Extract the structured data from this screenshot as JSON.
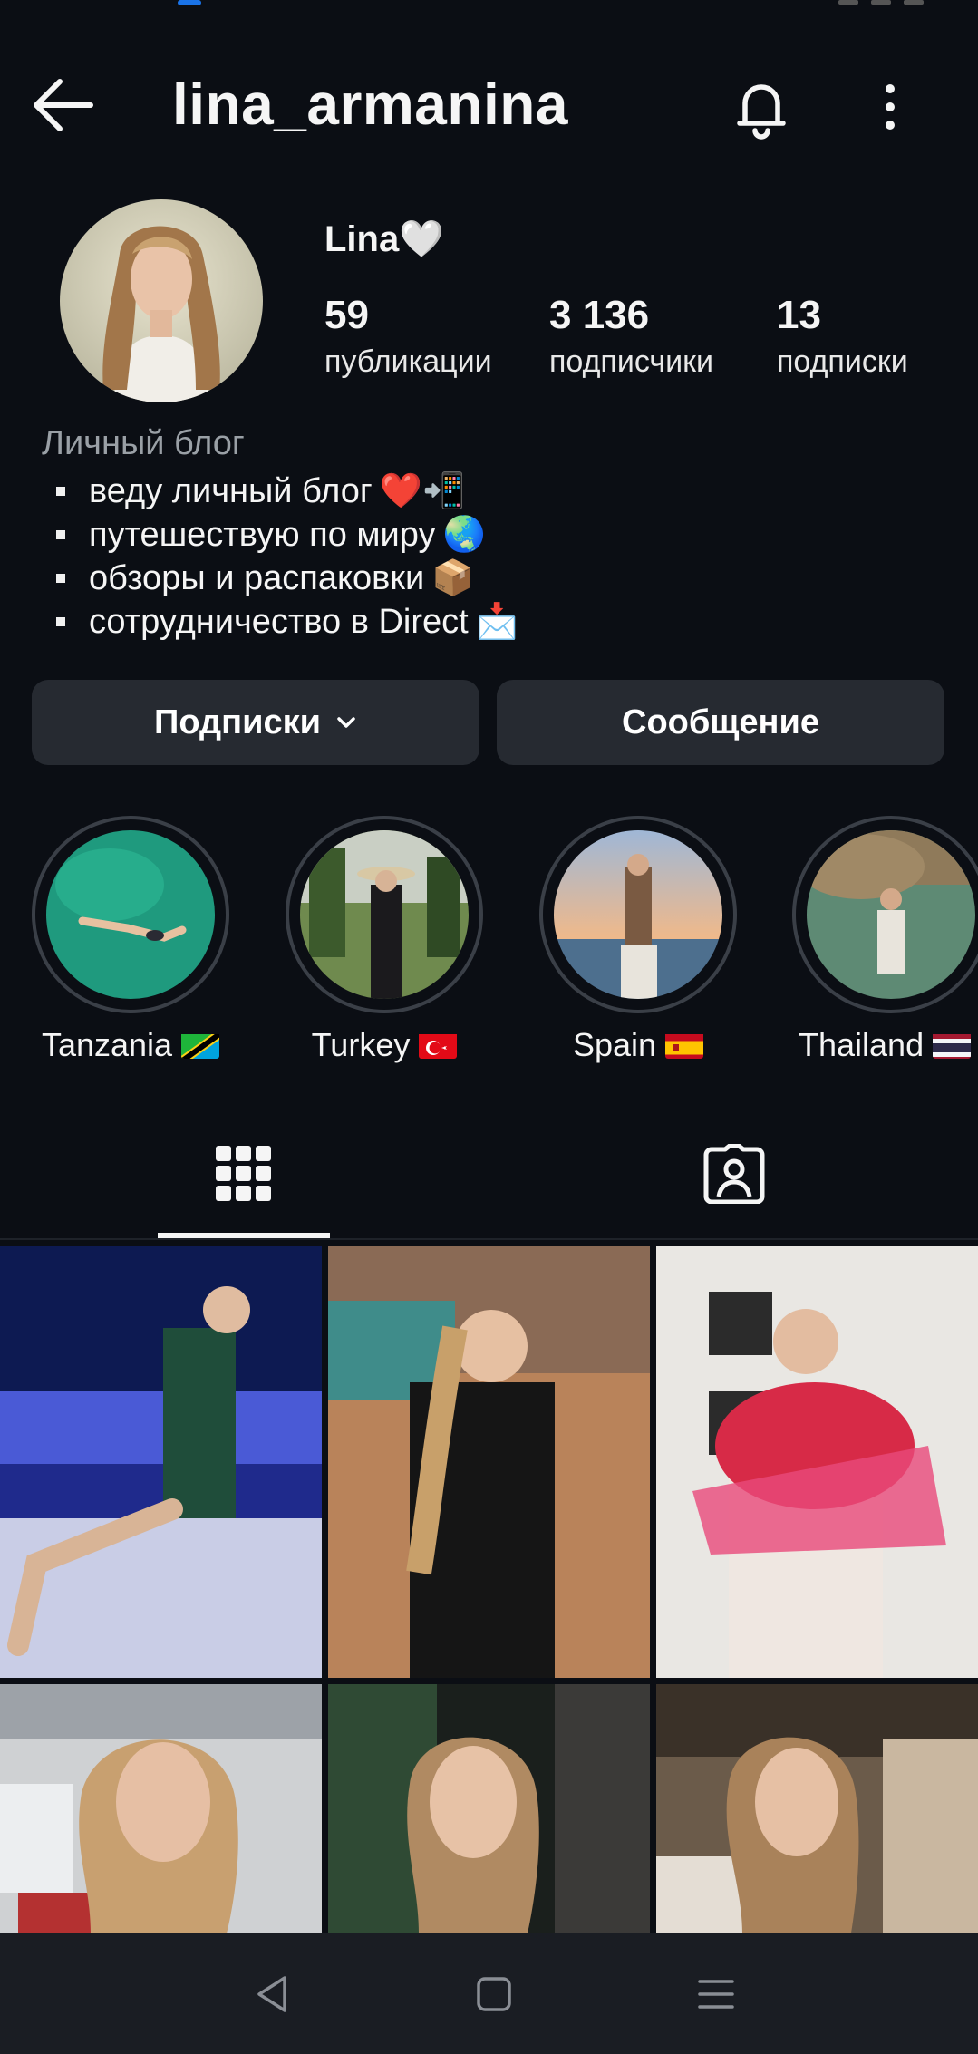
{
  "header": {
    "username": "lina_armanina"
  },
  "profile": {
    "display_name": "Lina🤍",
    "stats": [
      {
        "value": "59",
        "label": "публикации"
      },
      {
        "value": "3 136",
        "label": "подписчики"
      },
      {
        "value": "13",
        "label": "подписки"
      }
    ],
    "category": "Личный блог",
    "bio": [
      {
        "text": "веду личный блог",
        "emoji": "❤️📲"
      },
      {
        "text": "путешествую по миру",
        "emoji": "🌏"
      },
      {
        "text": "обзоры и распаковки",
        "emoji": "📦"
      },
      {
        "text": "сотрудничество в Direct",
        "emoji": "📩"
      }
    ]
  },
  "actions": {
    "following_label": "Подписки",
    "message_label": "Сообщение"
  },
  "highlights": [
    {
      "label": "Tanzania",
      "flag": "tanzania-flag"
    },
    {
      "label": "Turkey",
      "flag": "turkey-flag"
    },
    {
      "label": "Spain",
      "flag": "spain-flag"
    },
    {
      "label": "Thailand",
      "flag": "thailand-flag"
    }
  ],
  "tabs": {
    "active": "posts-grid",
    "items": [
      "grid-icon",
      "tagged-icon"
    ]
  },
  "colors": {
    "background": "#0b0e14",
    "button_bg": "#262a31",
    "category_text": "#9aa0a6"
  }
}
